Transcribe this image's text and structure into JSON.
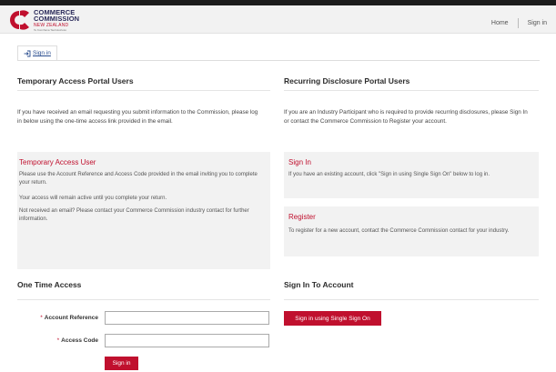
{
  "header": {
    "logo": {
      "line1": "COMMERCE",
      "line2": "COMMISSION",
      "line3": "NEW ZEALAND",
      "line4": "Te Komihana Tauhokohoko"
    },
    "nav": {
      "home": "Home",
      "sign_in": "Sign in"
    }
  },
  "tab": {
    "label": "Sign in",
    "icon": "sign-in-icon"
  },
  "left": {
    "title": "Temporary Access Portal Users",
    "intro": "If you have received an email requesting you submit information to the Commission, please log in below using the one-time access link provided in the email.",
    "panel": {
      "title": "Temporary Access User",
      "p1": "Please use the Account Reference and Access Code provided in the email inviting you to complete your return.",
      "p2": "Your access will remain active until you complete your return.",
      "p3": "Not received an email? Please contact your Commerce Commission industry contact for further information."
    },
    "form": {
      "title": "One Time Access",
      "account_reference_label": "Account Reference",
      "access_code_label": "Access Code",
      "required_mark": "*",
      "account_reference_value": "",
      "access_code_value": "",
      "submit_label": "Sign in"
    }
  },
  "right": {
    "title": "Recurring Disclosure Portal Users",
    "intro": "If you are an Industry Participant who is required to provide recurring disclosures, please Sign In or contact the Commerce Commission to Register your account.",
    "signin_panel": {
      "title": "Sign In",
      "text": "If you have an existing account, click \"Sign in using Single Sign On\" below to log in."
    },
    "register_panel": {
      "title": "Register",
      "text": "To register for a new account, contact the Commerce Commission contact for your industry."
    },
    "account": {
      "title": "Sign In To Account",
      "sso_button": "Sign in using Single Sign On"
    }
  },
  "colors": {
    "brand_red": "#c0102e",
    "brand_navy": "#2a2a5a",
    "panel_bg": "#f2f2f2"
  }
}
